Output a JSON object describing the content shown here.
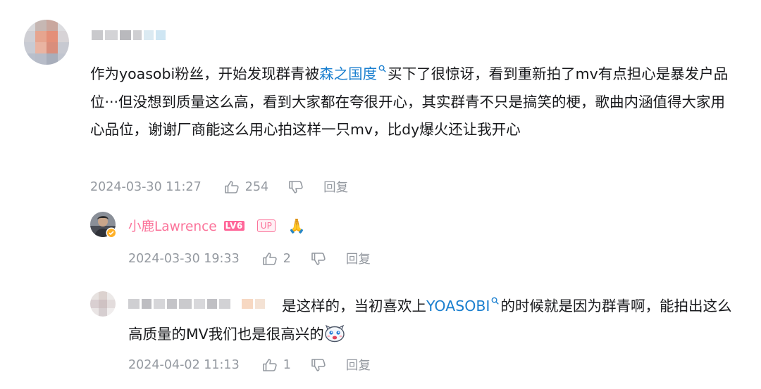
{
  "comment": {
    "text_before_link": "作为yoasobi粉丝，开始发现群青被",
    "link_text": "森之国度",
    "text_after_link": "买下了很惊讶，看到重新拍了mv有点担心是暴发户品位···但没想到质量这么高，看到大家都在夸很开心，其实群青不只是搞笑的梗，歌曲内涵值得大家用心品位，谢谢厂商能这么用心拍这样一只mv，比dy爆火还让我开心",
    "date": "2024-03-30 11:27",
    "likes": "254",
    "reply_label": "回复"
  },
  "reply1": {
    "username": "小鹿Lawrence",
    "level_badge": "LV6",
    "up_badge": "UP",
    "content_emoji": "🙏",
    "date": "2024-03-30 19:33",
    "likes": "2",
    "reply_label": "回复"
  },
  "reply2": {
    "text_before_link": "是这样的，当初喜欢上",
    "link_text": "YOASOBI",
    "text_after_link": "的时候就是因为群青啊，能拍出这么高质量的MV我们也是很高兴的",
    "date": "2024-04-02 11:13",
    "likes": "1",
    "reply_label": "回复"
  },
  "colors": {
    "link": "#1a7fcf",
    "username_vip": "#fb7299",
    "meta_grey": "#9499a0"
  },
  "icons": [
    "thumbs-up-icon",
    "thumbs-down-icon",
    "search-icon",
    "verified-badge-icon",
    "pray-emoji-icon",
    "sticker-icon"
  ]
}
